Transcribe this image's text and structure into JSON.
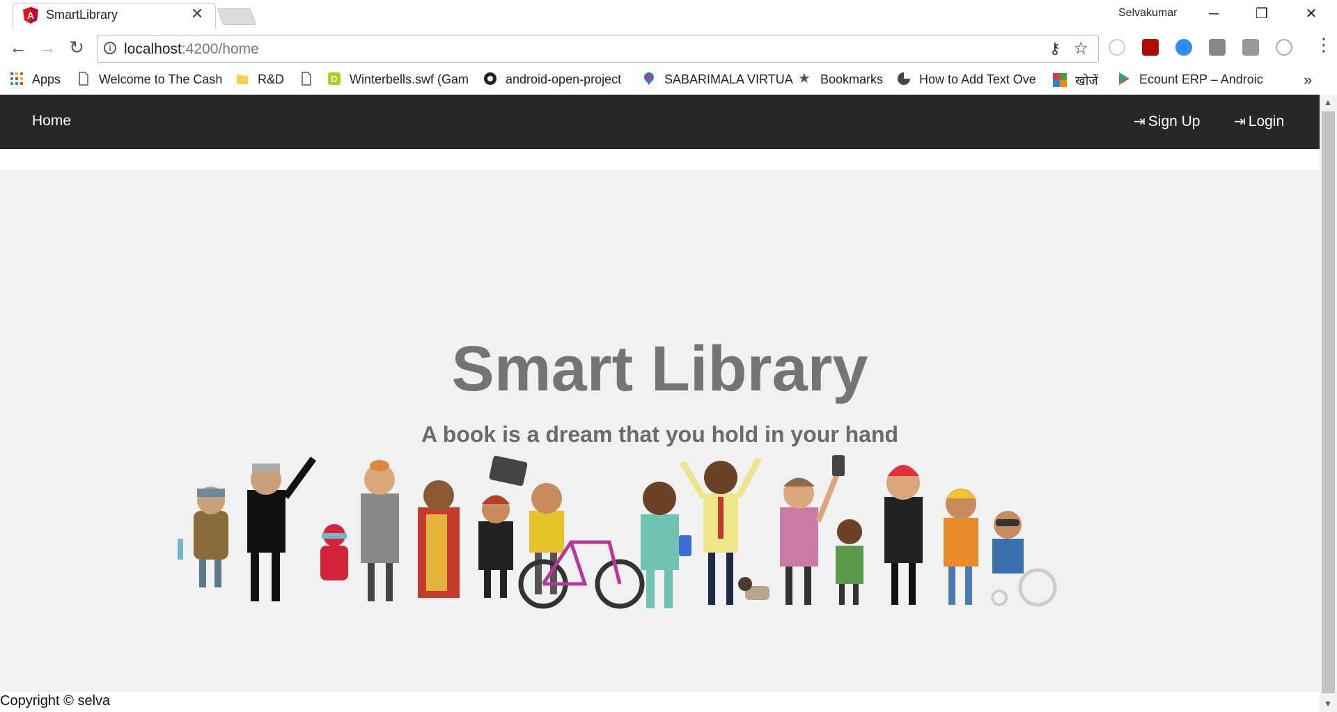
{
  "browser": {
    "tab_title": "SmartLibrary",
    "profile_name": "Selvakumar",
    "url_host": "localhost",
    "url_path": ":4200/home",
    "bookmarks": [
      {
        "label": "Apps",
        "icon": "apps-grid-icon"
      },
      {
        "label": "Welcome to The Cash",
        "icon": "page-icon"
      },
      {
        "label": "R&D",
        "icon": "folder-icon"
      },
      {
        "label": "",
        "icon": "page-icon"
      },
      {
        "label": "Winterbells.swf (Gam",
        "icon": "game-icon"
      },
      {
        "label": "android-open-project",
        "icon": "github-icon"
      },
      {
        "label": "SABARIMALA VIRTUA",
        "icon": "map-pin-icon"
      },
      {
        "label": "Bookmarks",
        "icon": "star-icon"
      },
      {
        "label": "How to Add Text Ove",
        "icon": "pie-icon"
      },
      {
        "label": "खोजें",
        "icon": "map-icon"
      },
      {
        "label": "Ecount ERP – Androic",
        "icon": "play-store-icon"
      }
    ],
    "more_bookmarks": "»"
  },
  "navbar": {
    "home": "Home",
    "signup": "Sign Up",
    "login": "Login"
  },
  "hero": {
    "title": "Smart Library",
    "subtitle": "A book is a dream that you hold in your hand"
  },
  "footer": {
    "copyright": "Copyright © selva"
  },
  "colors": {
    "navbar_bg": "#262729",
    "hero_bg": "#f1f1f1",
    "title_color": "#747474"
  }
}
